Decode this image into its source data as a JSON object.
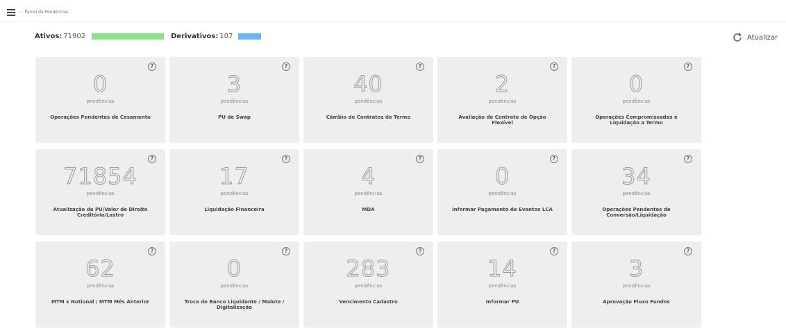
{
  "header": {
    "breadcrumb": "Painel de Pendências"
  },
  "stats": {
    "ativos_label": "Ativos:",
    "ativos_value": "71902",
    "derivativos_label": "Derivativos:",
    "derivativos_value": "107",
    "colors": {
      "ativos_bar": "#8fe08a",
      "derivativos_bar": "#6db4f2"
    }
  },
  "toolbar": {
    "refresh_label": "Atualizar",
    "refresh_icon": "refresh-icon"
  },
  "cards": [
    {
      "count": "0",
      "pending_label": "pendências",
      "title": "Operações Pendentes de Casamento"
    },
    {
      "count": "3",
      "pending_label": "pendências",
      "title": "PU de Swap"
    },
    {
      "count": "40",
      "pending_label": "pendências",
      "title": "Câmbio de Contratos de Termo"
    },
    {
      "count": "2",
      "pending_label": "pendências",
      "title": "Avaliação de Contrato de Opção Flexível"
    },
    {
      "count": "0",
      "pending_label": "pendências",
      "title": "Operações Compromissadas e Liquidação a Termo"
    },
    {
      "count": "71854",
      "pending_label": "pendências",
      "title": "Atualização de PU/Valor de Direito Creditório/Lastro"
    },
    {
      "count": "17",
      "pending_label": "pendências",
      "title": "Liquidação Financeira"
    },
    {
      "count": "4",
      "pending_label": "pendências",
      "title": "MDA"
    },
    {
      "count": "0",
      "pending_label": "pendências",
      "title": "Informar Pagamento de Eventos LCA"
    },
    {
      "count": "34",
      "pending_label": "pendências",
      "title": "Operações Pendentes de Conversão/Liquidação"
    },
    {
      "count": "62",
      "pending_label": "pendências",
      "title": "MTM x Notional / MTM Mês Anterior"
    },
    {
      "count": "0",
      "pending_label": "pendências",
      "title": "Troca de Banco Liquidante / Malote / Digitalização"
    },
    {
      "count": "283",
      "pending_label": "pendências",
      "title": "Vencimento Cadastro"
    },
    {
      "count": "14",
      "pending_label": "pendências",
      "title": "Informar PU"
    },
    {
      "count": "3",
      "pending_label": "pendências",
      "title": "Aprovação Fluxo Fundos"
    }
  ]
}
